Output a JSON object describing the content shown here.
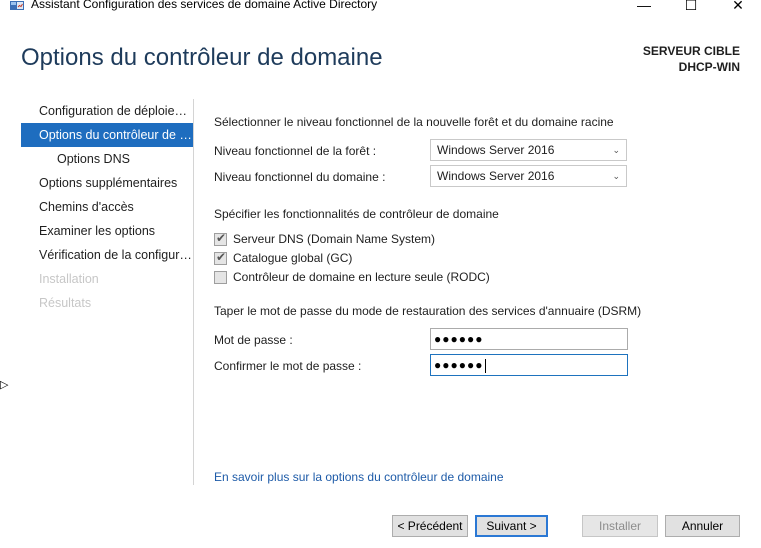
{
  "window": {
    "title": "Assistant Configuration des services de domaine Active Directory",
    "minimize_glyph": "—",
    "maximize_glyph": "☐",
    "close_glyph": "✕",
    "icon": "server-manager-icon"
  },
  "header": {
    "title": "Options du contrôleur de domaine",
    "target_label": "SERVEUR CIBLE",
    "target_name": "DHCP-WIN"
  },
  "sidebar": {
    "items": [
      {
        "label": "Configuration de déploiement",
        "state": "normal"
      },
      {
        "label": "Options du contrôleur de domaine",
        "state": "active"
      },
      {
        "label": "Options DNS",
        "state": "sub"
      },
      {
        "label": "Options supplémentaires",
        "state": "normal"
      },
      {
        "label": "Chemins d'accès",
        "state": "normal"
      },
      {
        "label": "Examiner les options",
        "state": "normal"
      },
      {
        "label": "Vérification de la configuration",
        "state": "normal"
      },
      {
        "label": "Installation",
        "state": "disabled"
      },
      {
        "label": "Résultats",
        "state": "disabled"
      }
    ]
  },
  "main": {
    "functional_level_heading": "Sélectionner le niveau fonctionnel de la nouvelle forêt et du domaine racine",
    "forest_level_label": "Niveau fonctionnel de la forêt :",
    "forest_level_value": "Windows Server 2016",
    "domain_level_label": "Niveau fonctionnel du domaine :",
    "domain_level_value": "Windows Server 2016",
    "capabilities_heading": "Spécifier les fonctionnalités de contrôleur de domaine",
    "capabilities": [
      {
        "label": "Serveur DNS (Domain Name System)",
        "checked": true
      },
      {
        "label": "Catalogue global (GC)",
        "checked": true
      },
      {
        "label": "Contrôleur de domaine en lecture seule (RODC)",
        "checked": false
      }
    ],
    "dsrm_heading": "Taper le mot de passe du mode de restauration des services d'annuaire (DSRM)",
    "password_label": "Mot de passe :",
    "password_value": "●●●●●●",
    "confirm_label": "Confirmer le mot de passe :",
    "confirm_value": "●●●●●●",
    "help_link": "En savoir plus sur la options du contrôleur de domaine",
    "chevron_glyph": "⌄",
    "check_glyph": "✔"
  },
  "footer": {
    "previous": "< Précédent",
    "next": "Suivant >",
    "install": "Installer",
    "cancel": "Annuler"
  },
  "colors": {
    "accent": "#1e6dbf",
    "heading": "#1e3b5b",
    "link": "#1e5ba8"
  }
}
